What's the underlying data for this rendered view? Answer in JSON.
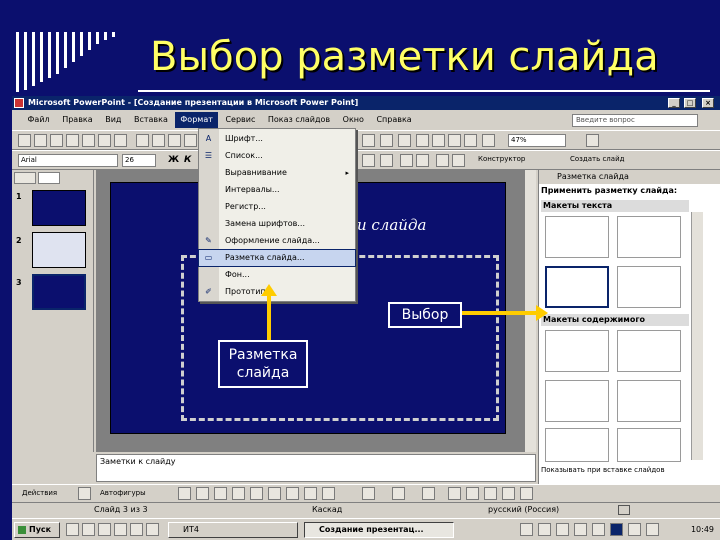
{
  "slide": {
    "title": "Выбор разметки слайда",
    "title_color": "#ffff66",
    "background_color": "#0b0f6e",
    "subtitle_fragment": "ки слайда"
  },
  "window": {
    "title": "Microsoft PowerPoint - [Создание презентации в Microsoft Power Point]",
    "controls": [
      "_",
      "□",
      "×"
    ],
    "menu": [
      "Файл",
      "Правка",
      "Вид",
      "Вставка",
      "Формат",
      "Сервис",
      "Показ слайдов",
      "Окно",
      "Справка"
    ],
    "active_menu": "Формат",
    "help_placeholder": "Введите вопрос"
  },
  "toolbar": {
    "zoom": "47%",
    "font": "Arial",
    "font_size": "26",
    "bold": "Ж",
    "italic": "К",
    "designer_label": "Конструктор",
    "new_slide_label": "Создать слайд"
  },
  "format_menu": {
    "items": [
      {
        "label": "Шрифт...",
        "icon": "font-icon",
        "glyph": "A"
      },
      {
        "label": "Список...",
        "icon": "list-icon",
        "glyph": "☰"
      },
      {
        "label": "Выравнивание",
        "icon": "",
        "glyph": "",
        "submenu": "▸"
      },
      {
        "label": "Интервалы...",
        "icon": "",
        "glyph": ""
      },
      {
        "label": "Регистр...",
        "icon": "",
        "glyph": ""
      },
      {
        "label": "Замена шрифтов...",
        "icon": "",
        "glyph": ""
      },
      {
        "label": "Оформление слайда...",
        "icon": "design-icon",
        "glyph": "✎"
      },
      {
        "label": "Разметка слайда...",
        "icon": "layout-icon",
        "glyph": "▭"
      },
      {
        "label": "Фон...",
        "icon": "",
        "glyph": ""
      },
      {
        "label": "Прототип...",
        "icon": "paint-icon",
        "glyph": "✐"
      }
    ]
  },
  "left_pane": {
    "slides": [
      "1",
      "2",
      "3"
    ]
  },
  "notes": {
    "placeholder": "Заметки к слайду"
  },
  "task_pane": {
    "title": "Разметка слайда",
    "apply_label": "Применить разметку слайда:",
    "section_text": "Макеты текста",
    "section_content": "Макеты содержимого",
    "show_on_insert": "Показывать при вставке слайдов"
  },
  "draw_toolbar": {
    "actions_label": "Действия",
    "autoshapes_label": "Автофигуры"
  },
  "status_bar": {
    "slide_info": "Слайд 3 из 3",
    "design": "Каскад",
    "language": "русский (Россия)"
  },
  "taskbar": {
    "start_label": "Пуск",
    "buttons": [
      "ИТ4",
      "Создание презентац..."
    ],
    "clock": "10:49"
  },
  "callouts": {
    "layout": "Разметка слайда",
    "choice": "Выбор"
  }
}
